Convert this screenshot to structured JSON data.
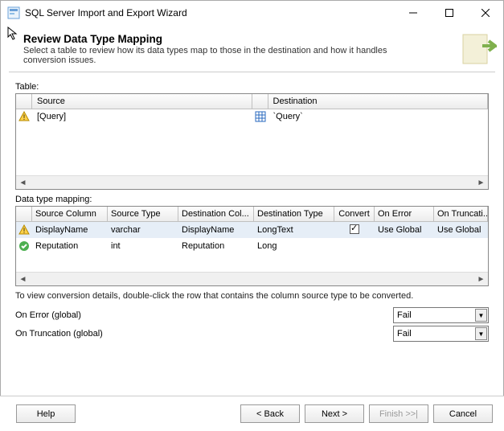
{
  "window": {
    "title": "SQL Server Import and Export Wizard"
  },
  "header": {
    "title": "Review Data Type Mapping",
    "subtitle": "Select a table to review how its data types map to those in the destination and how it handles conversion issues."
  },
  "table_section": {
    "label": "Table:",
    "columns": {
      "source": "Source",
      "destination": "Destination"
    },
    "rows": [
      {
        "source": "[Query]",
        "destination": "`Query`",
        "status": "warning"
      }
    ]
  },
  "mapping_section": {
    "label": "Data type mapping:",
    "columns": {
      "source_col": "Source Column",
      "source_type": "Source Type",
      "dest_col": "Destination Col...",
      "dest_type": "Destination Type",
      "convert": "Convert",
      "on_error": "On Error",
      "on_trunc": "On Truncati..."
    },
    "rows": [
      {
        "status": "warning",
        "source_col": "DisplayName",
        "source_type": "varchar",
        "dest_col": "DisplayName",
        "dest_type": "LongText",
        "convert": true,
        "on_error": "Use Global",
        "on_trunc": "Use Global"
      },
      {
        "status": "ok",
        "source_col": "Reputation",
        "source_type": "int",
        "dest_col": "Reputation",
        "dest_type": "Long",
        "convert": false,
        "on_error": "",
        "on_trunc": ""
      }
    ],
    "hint": "To view conversion details, double-click the row that contains the column source type to be converted."
  },
  "globals": {
    "on_error_label": "On Error (global)",
    "on_error_value": "Fail",
    "on_trunc_label": "On Truncation (global)",
    "on_trunc_value": "Fail"
  },
  "buttons": {
    "help": "Help",
    "back": "< Back",
    "next": "Next >",
    "finish": "Finish >>|",
    "cancel": "Cancel"
  }
}
